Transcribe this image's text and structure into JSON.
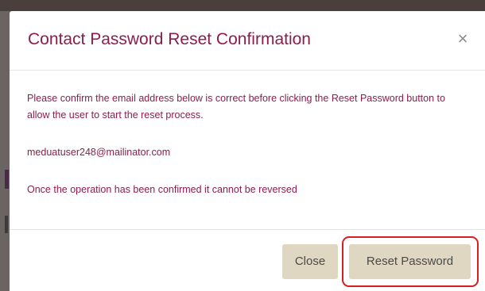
{
  "dialog": {
    "title": "Contact Password Reset Confirmation",
    "close_symbol": "×",
    "message": "Please confirm the email address below is correct before clicking the Reset Password button to allow the user to start the reset process.",
    "email": "meduatuser248@mailinator.com",
    "warning": "Once the operation has been confirmed it cannot be reversed"
  },
  "footer": {
    "close_label": "Close",
    "reset_label": "Reset Password"
  },
  "colors": {
    "title": "#8c1d4e",
    "body_text": "#8c1d4e",
    "button_bg": "#e0d7c2",
    "highlight": "#d42020"
  }
}
